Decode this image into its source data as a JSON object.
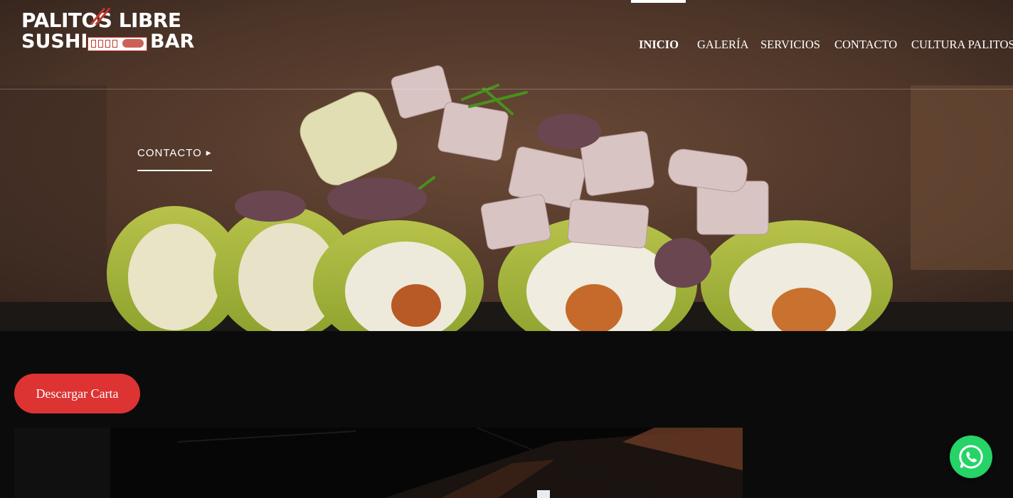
{
  "brand": {
    "line1": "PALITOS LIBRE",
    "line2_left": "SUSHI",
    "line2_right": "BAR",
    "logo_icon": "chopsticks-icon"
  },
  "nav": {
    "items": [
      {
        "label": "INICIO",
        "active": true
      },
      {
        "label": "GALERÍA",
        "active": false
      },
      {
        "label": "SERVICIOS",
        "active": false
      },
      {
        "label": "CONTACTO",
        "active": false
      },
      {
        "label": "CULTURA PALITOS",
        "active": false
      }
    ]
  },
  "hero": {
    "cta_label": "CONTACTO",
    "cta_icon": "triangle-right-icon",
    "image_subject": "sushi-roll-photo"
  },
  "main": {
    "download_label": "Descargar Carta",
    "photo_subject": "night-street-photo"
  },
  "whatsapp": {
    "icon": "whatsapp-icon",
    "color": "#25d366"
  },
  "colors": {
    "accent": "#dd3333",
    "background": "#0b0b0b",
    "text": "#ffffff"
  }
}
